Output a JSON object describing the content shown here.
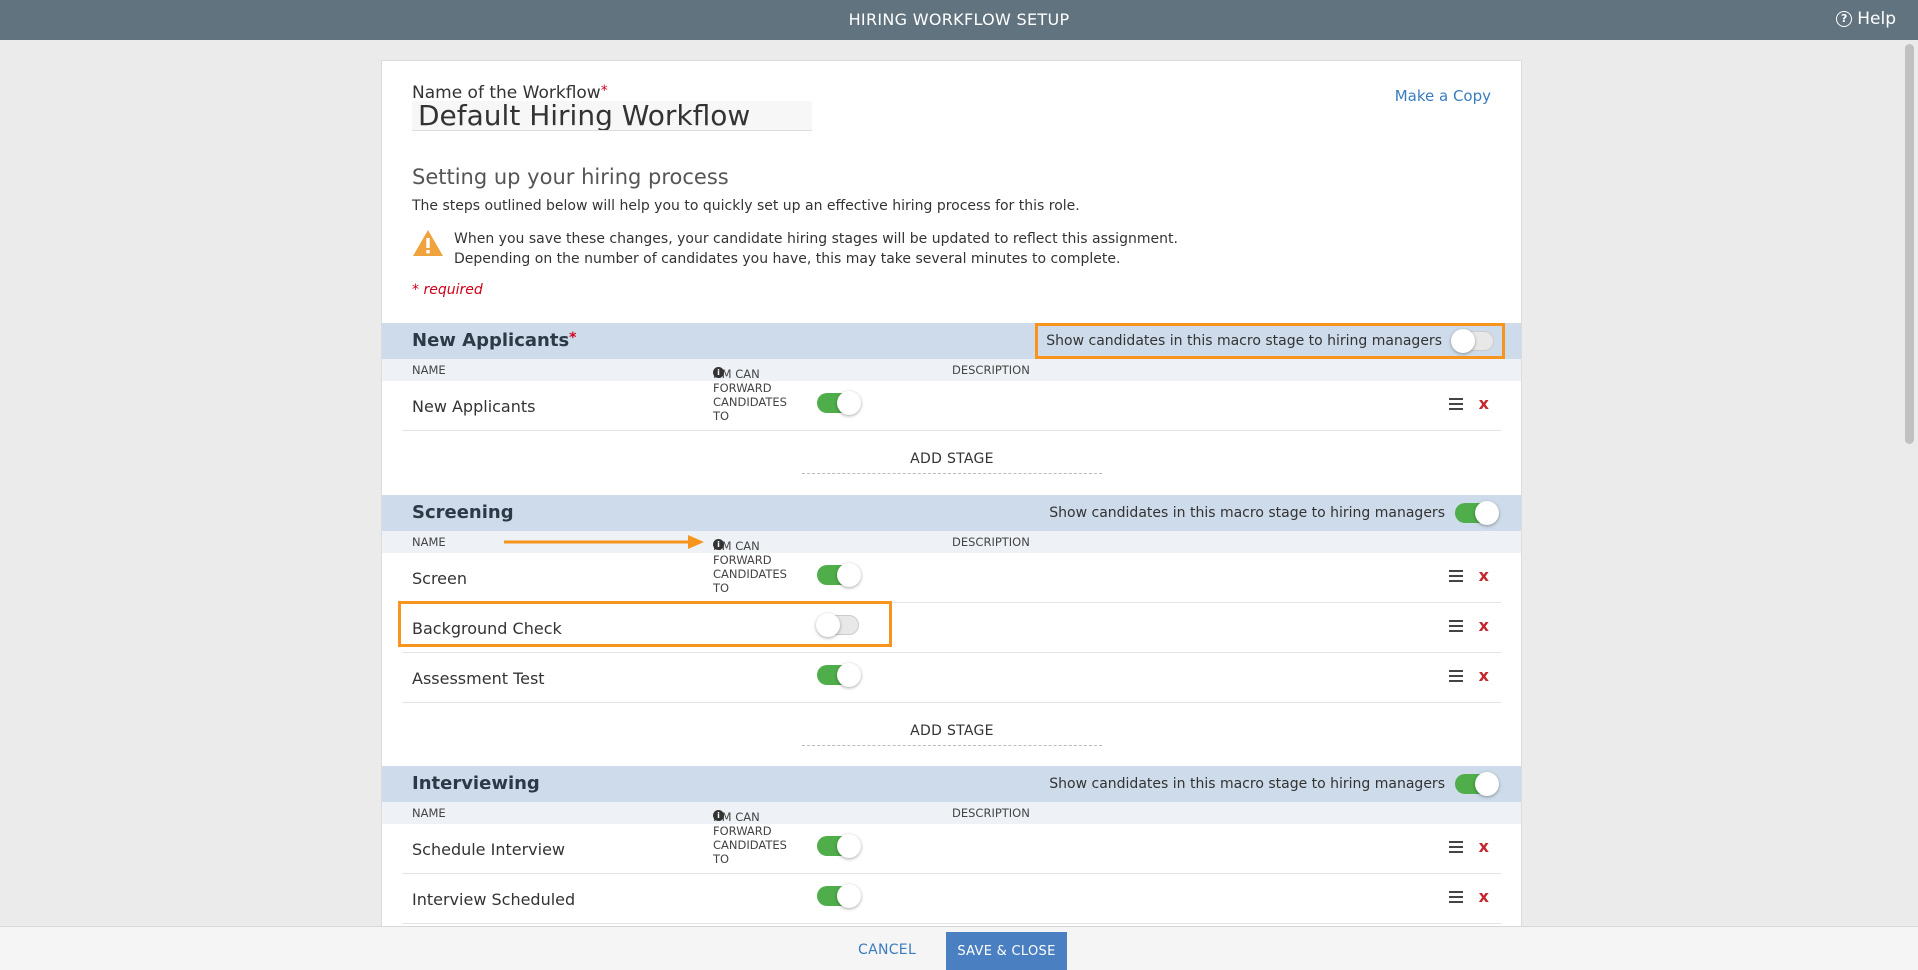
{
  "header": {
    "title": "HIRING WORKFLOW SETUP",
    "help_label": "Help"
  },
  "workflow": {
    "name_label": "Name of the Workflow",
    "required_star": "*",
    "name_value": "Default Hiring Workflow",
    "make_copy_label": "Make a Copy"
  },
  "intro": {
    "title": "Setting up your hiring process",
    "description": "The steps outlined below will help you to quickly set up an effective hiring process for this role.",
    "warning_line1": "When you save these changes, your candidate hiring stages will be updated to reflect this assignment.",
    "warning_line2": "Depending on the number of candidates you have, this may take several minutes to complete.",
    "required_note": "* required"
  },
  "columns": {
    "name": "NAME",
    "hm_forward": "HM CAN FORWARD CANDIDATES TO",
    "description": "DESCRIPTION"
  },
  "macro_stages": [
    {
      "title": "New Applicants",
      "required": "*",
      "show_label": "Show candidates in this macro stage to hiring managers",
      "show_on": false,
      "stages": [
        {
          "name": "New Applicants",
          "hm_forward": true
        }
      ],
      "add_stage_label": "ADD STAGE"
    },
    {
      "title": "Screening",
      "show_label": "Show candidates in this macro stage to hiring managers",
      "show_on": true,
      "stages": [
        {
          "name": "Screen",
          "hm_forward": true
        },
        {
          "name": "Background Check",
          "hm_forward": false
        },
        {
          "name": "Assessment Test",
          "hm_forward": true
        }
      ],
      "add_stage_label": "ADD STAGE"
    },
    {
      "title": "Interviewing",
      "show_label": "Show candidates in this macro stage to hiring managers",
      "show_on": true,
      "stages": [
        {
          "name": "Schedule Interview",
          "hm_forward": true
        },
        {
          "name": "Interview Scheduled",
          "hm_forward": true
        }
      ]
    }
  ],
  "icons": {
    "help": "question-circle-icon",
    "warning": "warning-triangle-icon",
    "info": "info-circle-icon",
    "drag": "drag-handle-icon",
    "delete": "delete-x-icon"
  },
  "delete_glyph": "x",
  "colors": {
    "topbar": "#627380",
    "macro_header": "#cddbea",
    "toggle_on": "#4fae4a",
    "highlight": "#f7941d",
    "delete": "#c1272d",
    "primary_button": "#4a7fc1",
    "link": "#3a7cc0"
  },
  "footer": {
    "cancel_label": "CANCEL",
    "save_label": "SAVE & CLOSE"
  }
}
